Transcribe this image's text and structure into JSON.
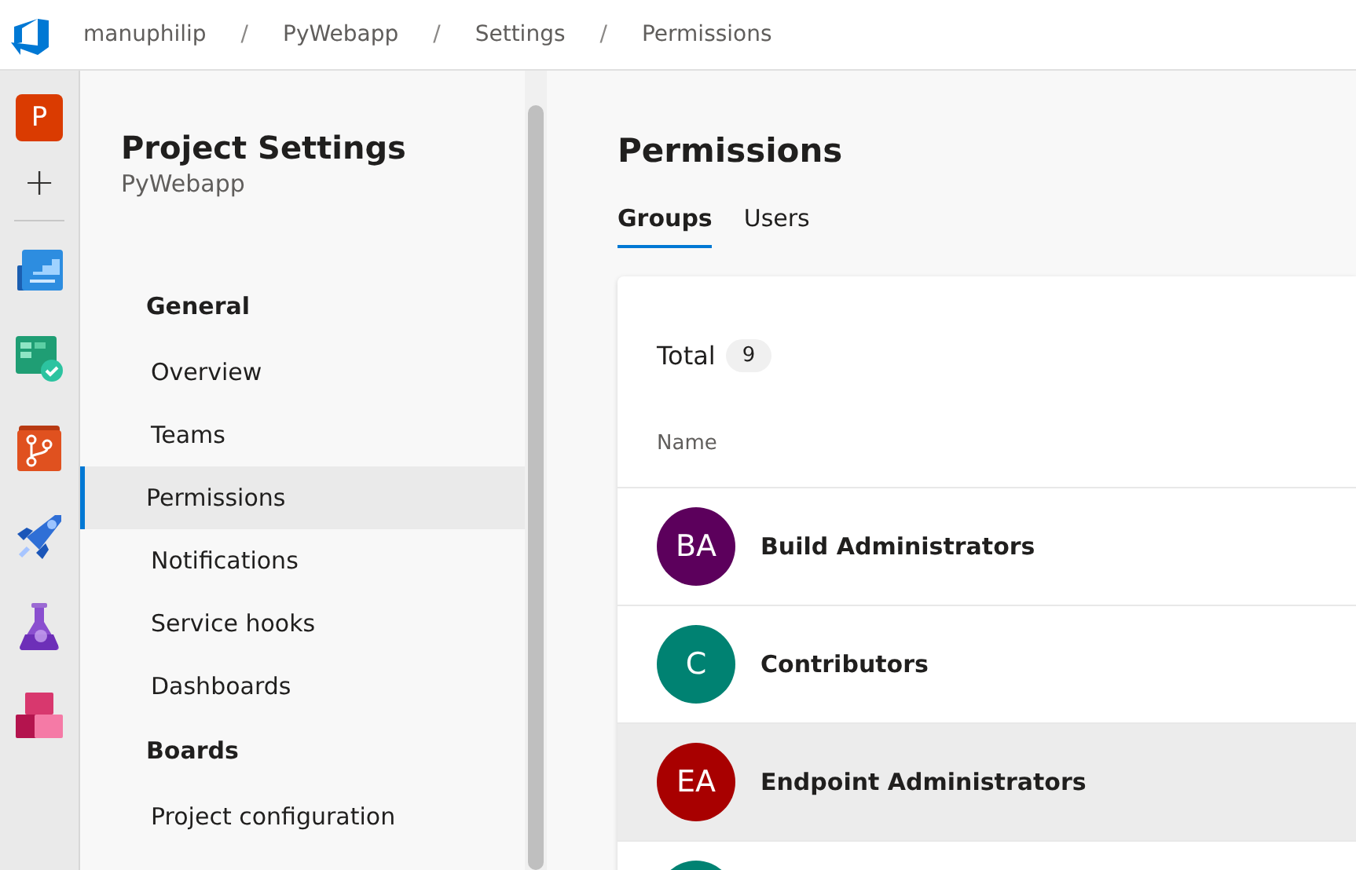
{
  "breadcrumb": [
    {
      "kind": "link",
      "text": "manuphilip"
    },
    {
      "kind": "separator",
      "text": "/"
    },
    {
      "kind": "link",
      "text": "PyWebapp"
    },
    {
      "kind": "separator",
      "text": "/"
    },
    {
      "kind": "link",
      "text": "Settings"
    },
    {
      "kind": "separator",
      "text": "/"
    },
    {
      "kind": "link",
      "text": "Permissions"
    }
  ],
  "rail": {
    "project_initial": "P",
    "add_glyph": "+"
  },
  "sidebar": {
    "title": "Project Settings",
    "subtitle": "PyWebapp",
    "sections": [
      {
        "heading": "General",
        "items": [
          {
            "label": "Overview",
            "selected": false
          },
          {
            "label": "Teams",
            "selected": false
          },
          {
            "label": "Permissions",
            "selected": true
          },
          {
            "label": "Notifications",
            "selected": false
          },
          {
            "label": "Service hooks",
            "selected": false
          },
          {
            "label": "Dashboards",
            "selected": false
          }
        ]
      },
      {
        "heading": "Boards",
        "items": [
          {
            "label": "Project configuration",
            "selected": false
          }
        ]
      }
    ]
  },
  "main": {
    "title": "Permissions",
    "tabs": [
      {
        "label": "Groups",
        "selected": true
      },
      {
        "label": "Users",
        "selected": false
      }
    ],
    "total_label": "Total",
    "total_count": "9",
    "column": "Name",
    "rows": [
      {
        "initials": "BA",
        "name": "Build Administrators",
        "color": "#5c005c",
        "hovered": false
      },
      {
        "initials": "C",
        "name": "Contributors",
        "color": "#008272",
        "hovered": false
      },
      {
        "initials": "EA",
        "name": "Endpoint Administrators",
        "color": "#a80000",
        "hovered": true
      },
      {
        "color": "#008272",
        "hovered": false
      }
    ]
  }
}
